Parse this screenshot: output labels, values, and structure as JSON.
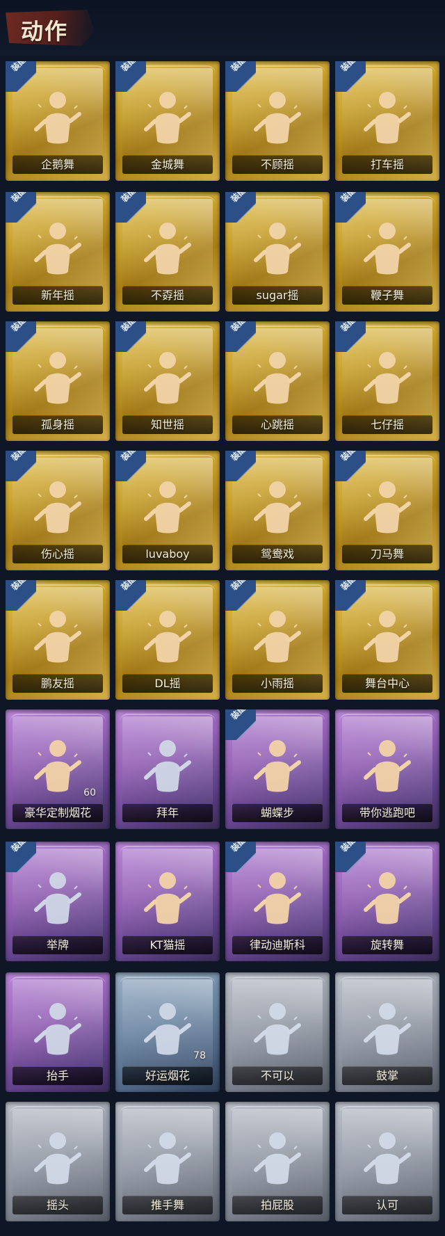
{
  "header": {
    "title": "动作"
  },
  "badge_text": "装配",
  "colors": {
    "gold": "#c79f2a",
    "purple": "#9461b6",
    "blue": "#6f8aa6",
    "gray": "#8f96a3",
    "figure_cream": "#f1d3a8",
    "figure_light": "#cfd7e6"
  },
  "items": [
    {
      "label": "企鹅舞",
      "rarity": "gold",
      "equipped": true,
      "icon": "penguin-dance-icon"
    },
    {
      "label": "金城舞",
      "rarity": "gold",
      "equipped": true,
      "icon": "kingcity-dance-icon"
    },
    {
      "label": "不顾摇",
      "rarity": "gold",
      "equipped": true,
      "icon": "buguyao-icon"
    },
    {
      "label": "打车摇",
      "rarity": "gold",
      "equipped": true,
      "icon": "dachayao-icon"
    },
    {
      "label": "新年摇",
      "rarity": "gold",
      "equipped": true,
      "icon": "newyear-sway-icon"
    },
    {
      "label": "不孬摇",
      "rarity": "gold",
      "equipped": true,
      "icon": "bunao-sway-icon"
    },
    {
      "label": "sugar摇",
      "rarity": "gold",
      "equipped": true,
      "icon": "sugar-sway-icon"
    },
    {
      "label": "鞭子舞",
      "rarity": "gold",
      "equipped": true,
      "icon": "whip-dance-icon"
    },
    {
      "label": "孤身摇",
      "rarity": "gold",
      "equipped": true,
      "icon": "lonely-sway-icon"
    },
    {
      "label": "知世摇",
      "rarity": "gold",
      "equipped": true,
      "icon": "zhishi-sway-icon"
    },
    {
      "label": "心跳摇",
      "rarity": "gold",
      "equipped": true,
      "icon": "heartbeat-sway-icon"
    },
    {
      "label": "七仔摇",
      "rarity": "gold",
      "equipped": true,
      "icon": "qizai-sway-icon"
    },
    {
      "label": "伤心摇",
      "rarity": "gold",
      "equipped": true,
      "icon": "sad-sway-icon"
    },
    {
      "label": "luvaboy",
      "rarity": "gold",
      "equipped": true,
      "icon": "luvaboy-icon"
    },
    {
      "label": "鸳鸯戏",
      "rarity": "gold",
      "equipped": true,
      "icon": "mandarin-duck-icon"
    },
    {
      "label": "刀马舞",
      "rarity": "gold",
      "equipped": true,
      "icon": "daoma-dance-icon"
    },
    {
      "label": "鹏友摇",
      "rarity": "gold",
      "equipped": true,
      "icon": "pengyou-sway-icon"
    },
    {
      "label": "DL摇",
      "rarity": "gold",
      "equipped": true,
      "icon": "dl-sway-icon"
    },
    {
      "label": "小雨摇",
      "rarity": "gold",
      "equipped": true,
      "icon": "xiaoyu-sway-icon"
    },
    {
      "label": "舞台中心",
      "rarity": "gold",
      "equipped": true,
      "icon": "center-stage-icon"
    },
    {
      "label": "豪华定制烟花",
      "rarity": "purple",
      "equipped": false,
      "icon": "fireworks-box-icon",
      "count": "60"
    },
    {
      "label": "拜年",
      "rarity": "purple",
      "equipped": false,
      "icon": "newyear-greeting-icon"
    },
    {
      "label": "蝴蝶步",
      "rarity": "purple",
      "equipped": true,
      "icon": "butterfly-step-icon"
    },
    {
      "label": "带你逃跑吧",
      "rarity": "purple",
      "equipped": false,
      "icon": "run-away-icon"
    },
    {
      "label": "举牌",
      "rarity": "purple",
      "equipped": true,
      "icon": "sign-hold-icon"
    },
    {
      "label": "KT猫摇",
      "rarity": "purple",
      "equipped": false,
      "icon": "kt-cat-sway-icon"
    },
    {
      "label": "律动迪斯科",
      "rarity": "purple",
      "equipped": true,
      "icon": "disco-icon"
    },
    {
      "label": "旋转舞",
      "rarity": "purple",
      "equipped": true,
      "icon": "spin-dance-icon"
    },
    {
      "label": "抬手",
      "rarity": "purple",
      "equipped": false,
      "icon": "raise-hand-icon"
    },
    {
      "label": "好运烟花",
      "rarity": "blue",
      "equipped": false,
      "icon": "lucky-fireworks-icon",
      "count": "78"
    },
    {
      "label": "不可以",
      "rarity": "gray",
      "equipped": false,
      "icon": "no-finger-icon"
    },
    {
      "label": "鼓掌",
      "rarity": "gray",
      "equipped": false,
      "icon": "clap-icon"
    },
    {
      "label": "摇头",
      "rarity": "gray",
      "equipped": false,
      "icon": "head-shake-icon"
    },
    {
      "label": "推手舞",
      "rarity": "gray",
      "equipped": false,
      "icon": "push-hand-dance-icon"
    },
    {
      "label": "拍屁股",
      "rarity": "gray",
      "equipped": false,
      "icon": "butt-pat-icon"
    },
    {
      "label": "认可",
      "rarity": "gray",
      "equipped": false,
      "icon": "thumbs-up-icon"
    }
  ]
}
